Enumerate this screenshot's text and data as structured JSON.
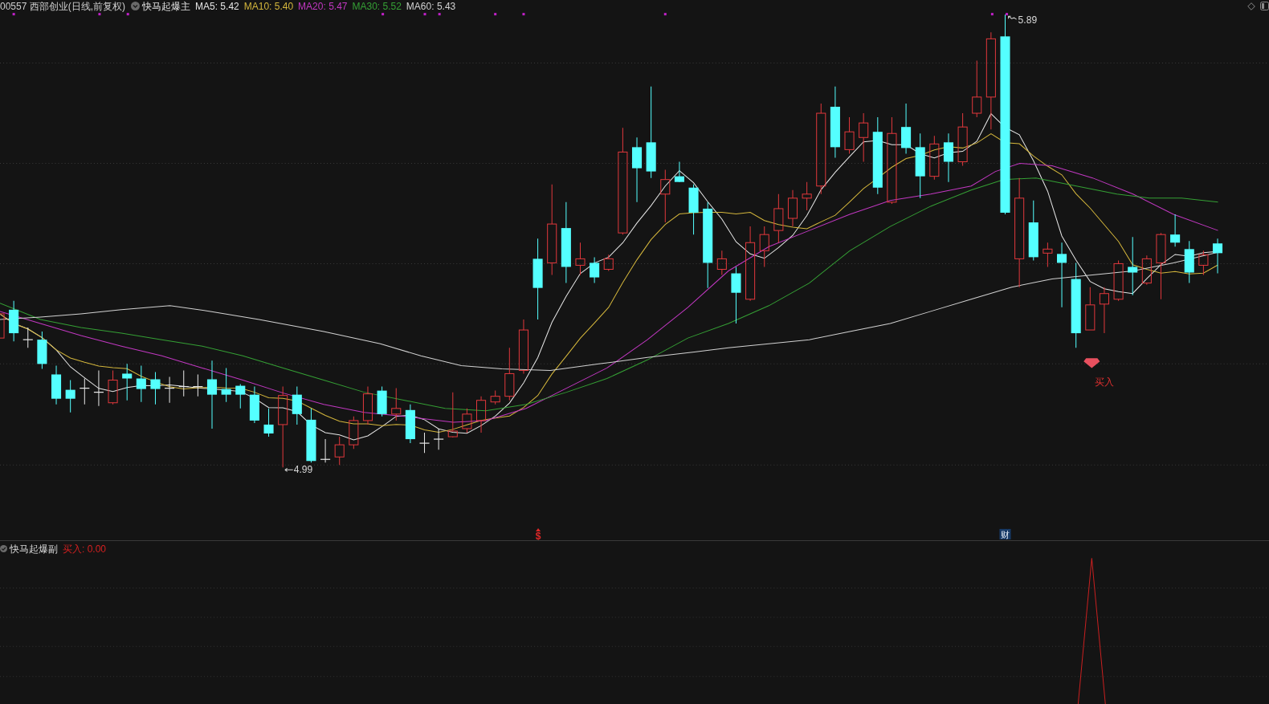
{
  "chart_header": {
    "symbol": "00557 西部创业(日线,前复权)",
    "indicator": "快马起爆主",
    "moving_averages": [
      {
        "label": "MA5: 5.42",
        "color": "#e6e6e6"
      },
      {
        "label": "MA10: 5.40",
        "color": "#d4b63c"
      },
      {
        "label": "MA20: 5.47",
        "color": "#c238c2"
      },
      {
        "label": "MA30: 5.52",
        "color": "#35a035"
      },
      {
        "label": "MA60: 5.43",
        "color": "#d2d2d2"
      }
    ]
  },
  "price_labels": [
    {
      "kind": "high",
      "text": "5.89"
    },
    {
      "kind": "low",
      "text": "4.99"
    }
  ],
  "signal": {
    "label": "买入"
  },
  "event_markers": [
    {
      "kind": "dollar",
      "text": "$"
    },
    {
      "kind": "finance",
      "text": "财"
    }
  ],
  "sub_panel": {
    "indicator": "快马起爆副",
    "reading": "买入: 0.00"
  }
}
